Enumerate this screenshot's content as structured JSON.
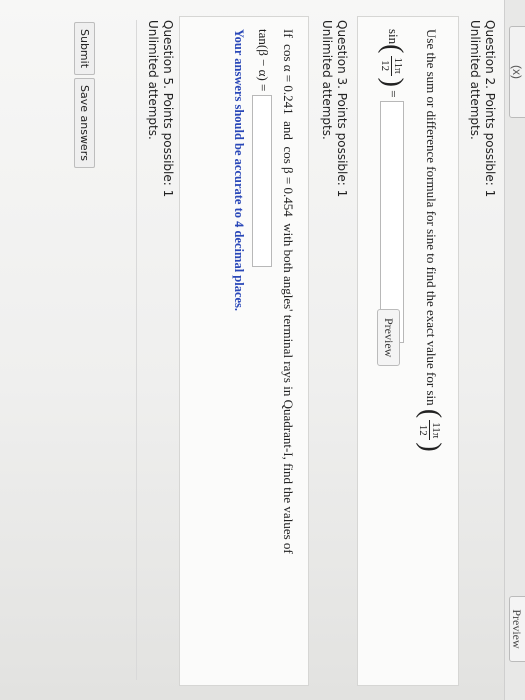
{
  "top": {
    "left_button": "(x)",
    "preview_button": "Preview"
  },
  "question2": {
    "title": "Question 2. Points possible: 1",
    "attempts": "Unlimited attempts.",
    "prompt": "Use the sum or difference formula for sine to find the exact value for sin",
    "frac_num": "11π",
    "frac_den": "12",
    "lhs_func": "sin",
    "equals": "=",
    "answer_value": "",
    "preview_label": "Preview"
  },
  "question3": {
    "title": "Question 3. Points possible: 1",
    "attempts": "Unlimited attempts.",
    "line1_if": "If",
    "line1_cos_a": "cos α = 0.241",
    "line1_and": "and",
    "line1_cos_b": "cos β = 0.454",
    "line1_rest": "with both angles' terminal rays in Quadrant-I, find the values of",
    "line2_expr": "tan(β − α) =",
    "answer_value": "",
    "instruction": "Your answers should be accurate to 4 decimal places."
  },
  "question5": {
    "title": "Question 5. Points possible: 1",
    "attempts": "Unlimited attempts."
  },
  "actions": {
    "submit": "Submit",
    "save": "Save answers"
  }
}
